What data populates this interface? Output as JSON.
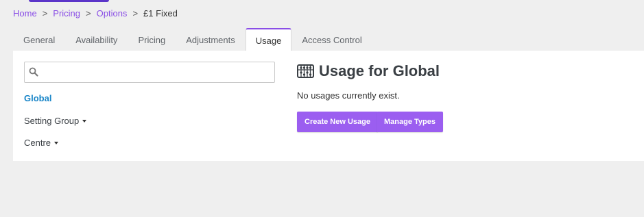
{
  "breadcrumb": {
    "items": [
      "Home",
      "Pricing",
      "Options"
    ],
    "separator": ">",
    "current": "£1 Fixed"
  },
  "tabs": [
    {
      "label": "General",
      "active": false
    },
    {
      "label": "Availability",
      "active": false
    },
    {
      "label": "Pricing",
      "active": false
    },
    {
      "label": "Adjustments",
      "active": false
    },
    {
      "label": "Usage",
      "active": true
    },
    {
      "label": "Access Control",
      "active": false
    }
  ],
  "sidebar": {
    "search": {
      "value": "",
      "placeholder": "",
      "icon": "search-icon"
    },
    "items": [
      {
        "label": "Global",
        "active": true
      },
      {
        "label": "Setting Group",
        "dropdown": true
      },
      {
        "label": "Centre",
        "dropdown": true
      }
    ]
  },
  "main": {
    "title_icon": "abacus-icon",
    "title": "Usage for Global",
    "empty_message": "No usages currently exist.",
    "buttons": {
      "create": "Create New Usage",
      "manage": "Manage Types"
    }
  },
  "colors": {
    "accent": "#9b5ef0",
    "link": "#8a4fe6",
    "active_item": "#1a86c8",
    "background": "#efefef"
  }
}
